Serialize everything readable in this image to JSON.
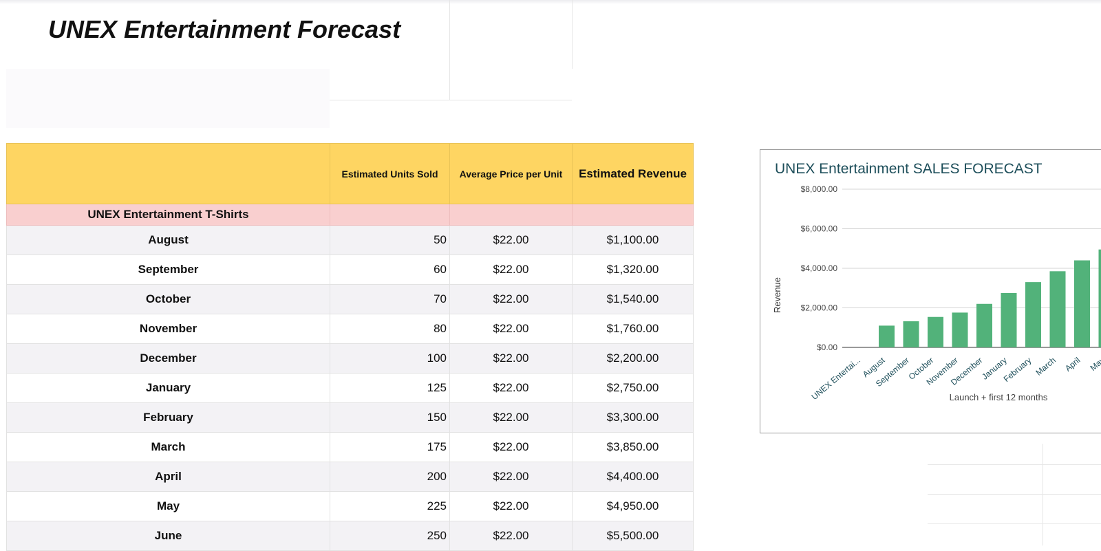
{
  "sheet": {
    "title": "UNEX Entertainment Forecast",
    "headers": {
      "item": "",
      "units": "Estimated Units Sold",
      "price": "Average Price per Unit",
      "revenue": "Estimated Revenue"
    },
    "group_label": "UNEX Entertainment T-Shirts",
    "rows": [
      {
        "month": "August",
        "units": "50",
        "price": "$22.00",
        "revenue": "$1,100.00"
      },
      {
        "month": "September",
        "units": "60",
        "price": "$22.00",
        "revenue": "$1,320.00"
      },
      {
        "month": "October",
        "units": "70",
        "price": "$22.00",
        "revenue": "$1,540.00"
      },
      {
        "month": "November",
        "units": "80",
        "price": "$22.00",
        "revenue": "$1,760.00"
      },
      {
        "month": "December",
        "units": "100",
        "price": "$22.00",
        "revenue": "$2,200.00"
      },
      {
        "month": "January",
        "units": "125",
        "price": "$22.00",
        "revenue": "$2,750.00"
      },
      {
        "month": "February",
        "units": "150",
        "price": "$22.00",
        "revenue": "$3,300.00"
      },
      {
        "month": "March",
        "units": "175",
        "price": "$22.00",
        "revenue": "$3,850.00"
      },
      {
        "month": "April",
        "units": "200",
        "price": "$22.00",
        "revenue": "$4,400.00"
      },
      {
        "month": "May",
        "units": "225",
        "price": "$22.00",
        "revenue": "$4,950.00"
      },
      {
        "month": "June",
        "units": "250",
        "price": "$22.00",
        "revenue": "$5,500.00"
      }
    ]
  },
  "colors": {
    "header_fill": "#fed562",
    "group_fill": "#f9cfcf",
    "alt_row_fill": "#f3f2f5",
    "bar_color": "#52b27a",
    "chart_title_color": "#1d4e5a"
  },
  "chart_data": {
    "type": "bar",
    "title": "UNEX Entertainment SALES FORECAST",
    "xlabel": "Launch + first 12 months",
    "ylabel": "Revenue",
    "categories": [
      "UNEX Entertai...",
      "August",
      "September",
      "October",
      "November",
      "December",
      "January",
      "February",
      "March",
      "April",
      "May"
    ],
    "values": [
      0,
      1100,
      1320,
      1540,
      1760,
      2200,
      2750,
      3300,
      3850,
      4400,
      4950
    ],
    "ylim": [
      0,
      8000
    ],
    "yticks": [
      "$0.00",
      "$2,000.00",
      "$4,000.00",
      "$6,000.00",
      "$8,000.00"
    ],
    "grid": true,
    "legend": "none"
  }
}
